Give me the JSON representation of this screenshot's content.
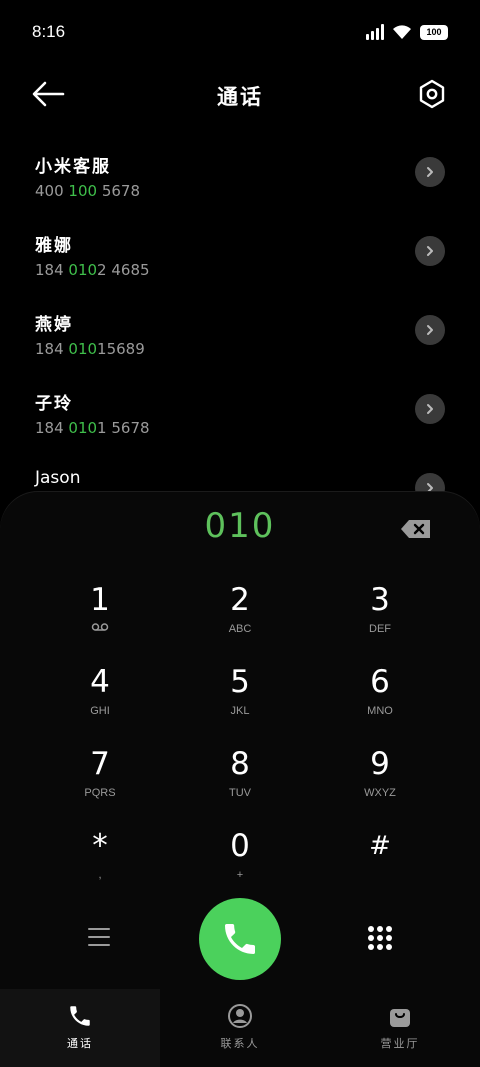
{
  "status_bar": {
    "time": "8:16",
    "battery": "100",
    "icons": [
      "signal-icon",
      "wifi-icon",
      "battery-icon"
    ]
  },
  "header": {
    "title": "通话",
    "back_icon": "arrow-left-icon",
    "settings_icon": "settings-icon"
  },
  "contacts": [
    {
      "name": "小米客服",
      "number_pre": "400 ",
      "number_match": "100",
      "number_post": " 5678"
    },
    {
      "name": "雅娜",
      "number_pre": "184 ",
      "number_match": "010",
      "number_post": "2 4685"
    },
    {
      "name": "燕婷",
      "number_pre": "184 ",
      "number_match": "010",
      "number_post": "15689"
    },
    {
      "name": "子玲",
      "number_pre": "184 ",
      "number_match": "010",
      "number_post": "1 5678"
    },
    {
      "name": "Jason",
      "number_pre": "",
      "number_match": "",
      "number_post": ""
    }
  ],
  "dialer": {
    "typed_number": "010",
    "keys": [
      {
        "digit": "1",
        "letters": ""
      },
      {
        "digit": "2",
        "letters": "ABC"
      },
      {
        "digit": "3",
        "letters": "DEF"
      },
      {
        "digit": "4",
        "letters": "GHI"
      },
      {
        "digit": "5",
        "letters": "JKL"
      },
      {
        "digit": "6",
        "letters": "MNO"
      },
      {
        "digit": "7",
        "letters": "PQRS"
      },
      {
        "digit": "8",
        "letters": "TUV"
      },
      {
        "digit": "9",
        "letters": "WXYZ"
      },
      {
        "digit": "*",
        "letters": ","
      },
      {
        "digit": "0",
        "letters": "+"
      },
      {
        "digit": "#",
        "letters": ""
      }
    ]
  },
  "bottom_nav": [
    {
      "label": "通话",
      "icon": "phone-icon"
    },
    {
      "label": "联系人",
      "icon": "contact-icon"
    },
    {
      "label": "营业厅",
      "icon": "bag-icon"
    }
  ],
  "colors": {
    "accent": "#4bd15c",
    "highlight": "#3fbf4b",
    "background": "#000000"
  }
}
